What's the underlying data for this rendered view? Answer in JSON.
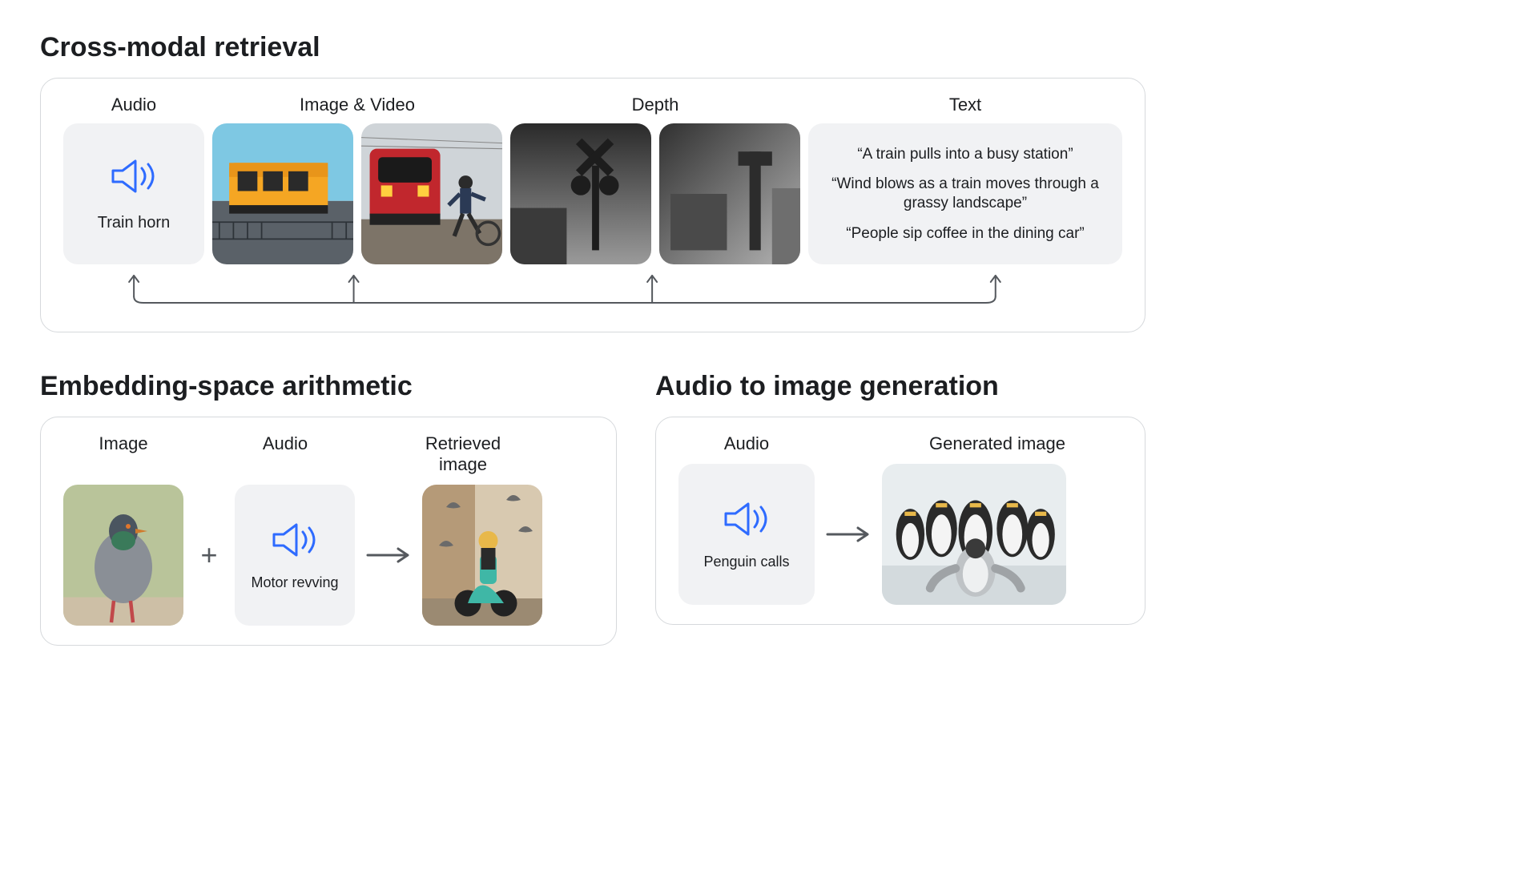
{
  "cross_modal": {
    "title": "Cross-modal retrieval",
    "columns": {
      "audio": "Audio",
      "image_video": "Image & Video",
      "depth": "Depth",
      "text": "Text"
    },
    "audio_label": "Train horn",
    "text_lines": [
      "“A train pulls into a busy station”",
      "“Wind blows as a train moves through a grassy landscape”",
      "“People sip coffee in the dining car”"
    ]
  },
  "embedding": {
    "title": "Embedding-space arithmetic",
    "columns": {
      "image": "Image",
      "audio": "Audio",
      "retrieved": "Retrieved image"
    },
    "audio_label": "Motor revving",
    "operator": "+"
  },
  "audio2img": {
    "title": "Audio to image generation",
    "columns": {
      "audio": "Audio",
      "generated": "Generated image"
    },
    "audio_label": "Penguin calls"
  }
}
